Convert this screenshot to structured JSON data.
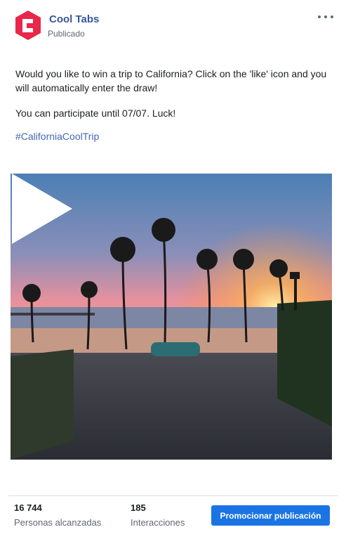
{
  "header": {
    "page_name": "Cool Tabs",
    "status": "Publicado",
    "more_icon": "more-horizontal-icon",
    "brand_color": "#e8274b"
  },
  "post": {
    "text_line1": "Would you like to win a trip to California? Click on the 'like' icon and you will automatically enter the draw!",
    "text_line2": "You can participate until 07/07. Luck!",
    "hashtag": "#CaliforniaCoolTrip"
  },
  "media": {
    "type": "video",
    "scene": "beach-sunset-palm-trees",
    "play_icon": "play-icon"
  },
  "footer": {
    "reach_value": "16 744",
    "reach_label": "Personas alcanzadas",
    "interactions_value": "185",
    "interactions_label": "Interacciones",
    "promote_label": "Promocionar publicación",
    "promote_color": "#1b74e4"
  }
}
